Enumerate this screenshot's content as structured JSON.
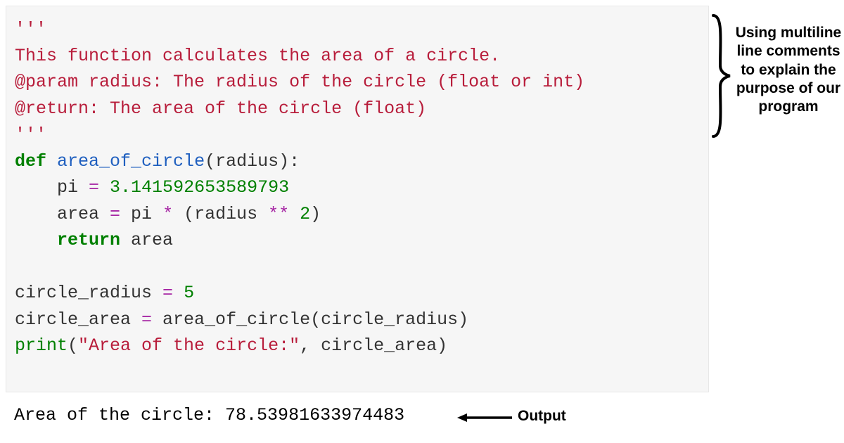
{
  "code": {
    "doc_open": "'''",
    "doc_line1": "This function calculates the area of a circle.",
    "doc_line2": "@param radius: The radius of the circle (float or int)",
    "doc_line3": "@return: The area of the circle (float)",
    "doc_close": "'''",
    "def_kw": "def",
    "fn_name": "area_of_circle",
    "fn_param": "(radius):",
    "indent": "    ",
    "line_pi_lhs": "pi ",
    "eq": "=",
    "pi_val": " 3.141592653589793",
    "area_lhs": "area ",
    "area_rhs": " pi ",
    "star": "*",
    "expr_open": " (radius ",
    "dstar": "**",
    "two": " 2",
    "expr_close": ")",
    "return_kw": "return",
    "return_val": " area",
    "assign1_lhs": "circle_radius ",
    "five": " 5",
    "assign2_lhs": "circle_area ",
    "call_name": " area_of_circle",
    "call_args": "(circle_radius)",
    "print_name": "print",
    "print_open": "(",
    "print_str": "\"Area of the circle:\"",
    "comma_arg": ", circle_area)",
    "output": "Area of the circle: 78.53981633974483"
  },
  "annotation": {
    "brace_text": "Using multiline line comments to explain the purpose of our program",
    "output_label": "Output"
  }
}
